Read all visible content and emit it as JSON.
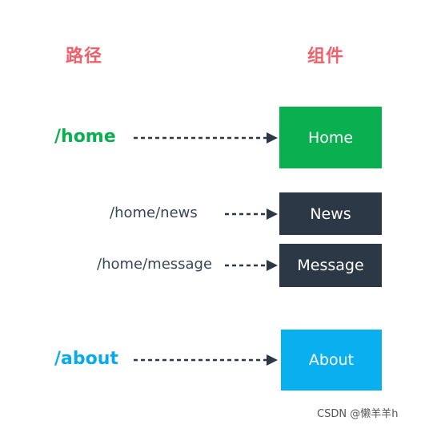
{
  "headings": {
    "path": "路径",
    "component": "组件"
  },
  "routes": [
    {
      "path": "/home",
      "component": "Home",
      "style": "main",
      "color": "#0aaf50",
      "box_color": "#0aaf50"
    },
    {
      "path": "/home/news",
      "component": "News",
      "style": "child",
      "color": "#3a4556",
      "box_color": "#2d3847"
    },
    {
      "path": "/home/message",
      "component": "Message",
      "style": "child",
      "color": "#3a4556",
      "box_color": "#2d3847"
    },
    {
      "path": "/about",
      "component": "About",
      "style": "main",
      "color": "#0aa9ee",
      "box_color": "#0aaff0"
    }
  ],
  "colors": {
    "heading": "#f0616b",
    "arrow": "#2d3847"
  },
  "watermark": "CSDN @懒羊羊h"
}
